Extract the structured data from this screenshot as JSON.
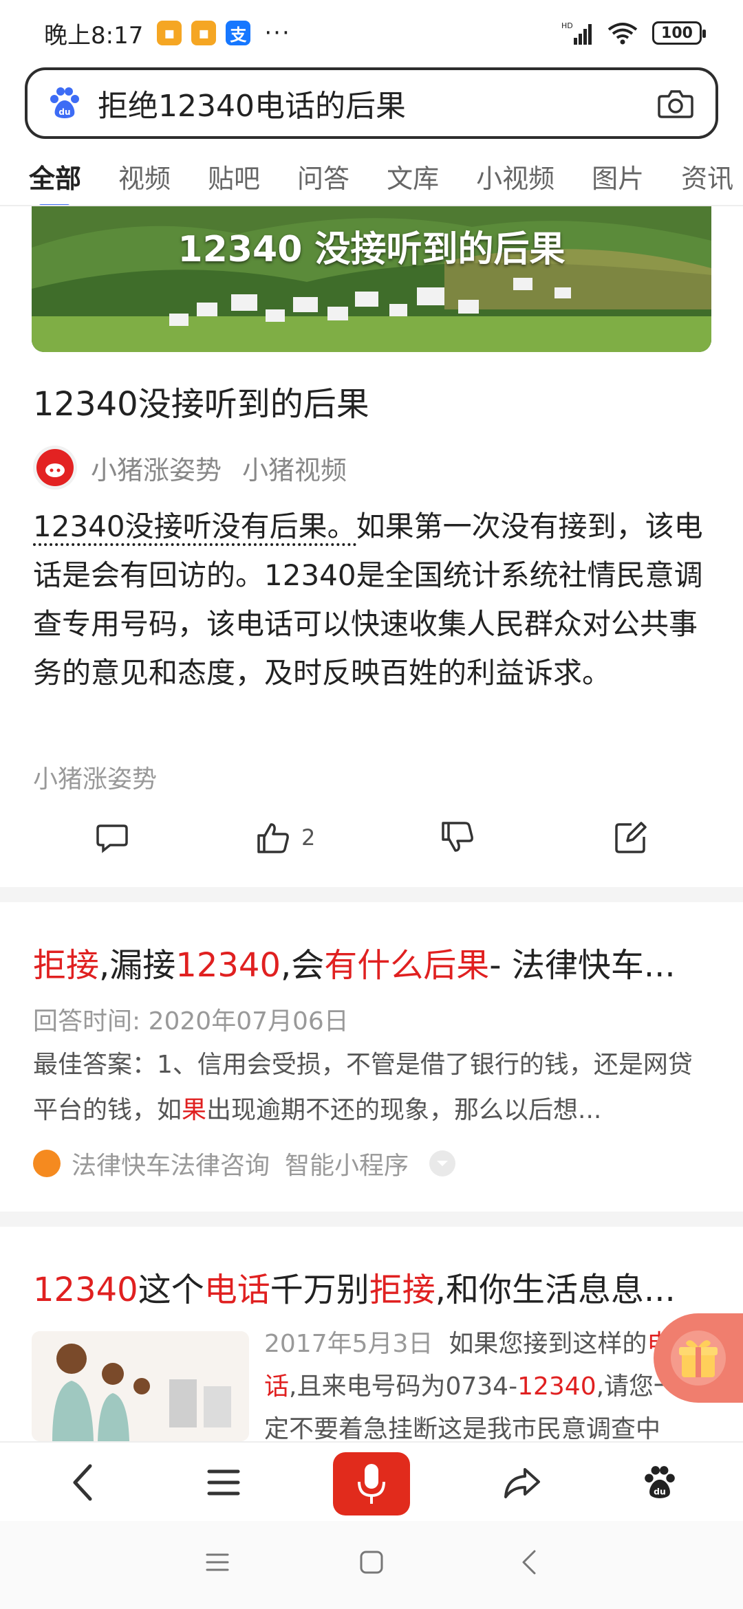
{
  "status_bar": {
    "time": "晚上8:17",
    "dots": "···",
    "network": "HD",
    "battery": "100"
  },
  "search": {
    "query": "拒绝12340电话的后果"
  },
  "tabs": [
    "全部",
    "视频",
    "贴吧",
    "问答",
    "文库",
    "小视频",
    "图片",
    "资讯"
  ],
  "card1": {
    "hero_caption": "12340 没接听到的后果",
    "title": "12340没接听到的后果",
    "author": "小猪涨姿势",
    "source": "小猪视频",
    "body_underlined": "12340没接听没有后果。",
    "body_rest": "如果第一次没有接到，该电话是会有回访的。12340是全国统计系统社情民意调查专用号码，该电话可以快速收集人民群众对公共事务的意见和态度，及时反映百姓的利益诉求。",
    "footer_source": "小猪涨姿势",
    "like_count": "2"
  },
  "card2": {
    "title_parts": [
      "拒接",
      ",漏接",
      "12340",
      ",会",
      "有什么后果",
      "- 法律快车..."
    ],
    "time": "回答时间: 2020年07月06日",
    "body_a": "最佳答案：1、信用会受损，不管是借了银行的钱，还是网贷平台的钱，如",
    "body_red": "果",
    "body_b": "出现逾期不还的现象，那么以后想...",
    "src_name": "法律快车法律咨询",
    "src_type": "智能小程序"
  },
  "card3": {
    "title_parts": [
      "12340",
      "这个",
      "电话",
      "千万别",
      "拒接",
      ",和你生活息息..."
    ],
    "date": "2017年5月3日",
    "body_a": "如果您接到这样的",
    "body_red1": "电话",
    "body_b": ",且来电号码为0734-",
    "body_red2": "12340",
    "body_c": ",请您一定不要着急挂断这是我市民意调查中"
  },
  "colors": {
    "accent": "#3d6cf5",
    "highlight_red": "#e02020",
    "mic_red": "#e12b1c"
  }
}
